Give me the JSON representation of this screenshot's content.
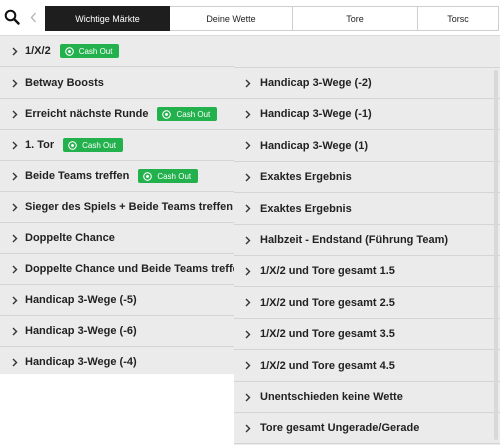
{
  "tabs": [
    {
      "label": "Wichtige Märkte",
      "active": true
    },
    {
      "label": "Deine Wette",
      "active": false
    },
    {
      "label": "Tore",
      "active": false
    },
    {
      "label": "Torsc",
      "active": false
    }
  ],
  "cash_out_label": "Cash Out",
  "left_markets": [
    {
      "label": "1/X/2",
      "cash_out": true
    },
    {
      "label": "Betway Boosts",
      "cash_out": false
    },
    {
      "label": "Erreicht nächste Runde",
      "cash_out": true
    },
    {
      "label": "1. Tor",
      "cash_out": true
    },
    {
      "label": "Beide Teams treffen",
      "cash_out": true
    },
    {
      "label": "Sieger des Spiels + Beide Teams treffen",
      "cash_out": false
    },
    {
      "label": "Doppelte Chance",
      "cash_out": false
    },
    {
      "label": "Doppelte Chance und Beide Teams treffen",
      "cash_out": false
    },
    {
      "label": "Handicap 3-Wege (-5)",
      "cash_out": false
    },
    {
      "label": "Handicap 3-Wege (-6)",
      "cash_out": false
    },
    {
      "label": "Handicap 3-Wege (-4)",
      "cash_out": false
    }
  ],
  "right_markets": [
    {
      "label": "Handicap 3-Wege (-2)"
    },
    {
      "label": "Handicap 3-Wege (-1)"
    },
    {
      "label": "Handicap 3-Wege (1)"
    },
    {
      "label": "Exaktes Ergebnis"
    },
    {
      "label": "Exaktes Ergebnis"
    },
    {
      "label": "Halbzeit - Endstand (Führung Team)"
    },
    {
      "label": "1/X/2 und Tore gesamt 1.5"
    },
    {
      "label": "1/X/2 und Tore gesamt 2.5"
    },
    {
      "label": "1/X/2 und Tore gesamt 3.5"
    },
    {
      "label": "1/X/2 und Tore gesamt 4.5"
    },
    {
      "label": "Unentschieden keine Wette"
    },
    {
      "label": "Tore gesamt Ungerade/Gerade"
    }
  ],
  "colors": {
    "accent_green": "#22b14c",
    "active_tab": "#1e1e1e",
    "row_bg": "#ebebeb"
  },
  "icons": {
    "search": "search-icon",
    "scroll_left": "chevron-left-icon",
    "row": "chevron-right-icon",
    "cash_out": "cash-out-icon"
  }
}
